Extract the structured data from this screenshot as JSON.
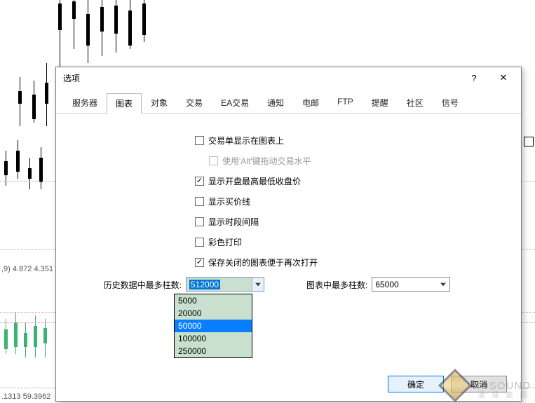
{
  "dialog": {
    "title": "选项",
    "helpGlyph": "?",
    "closeGlyph": "✕"
  },
  "tabs": [
    {
      "label": "服务器"
    },
    {
      "label": "图表"
    },
    {
      "label": "对象"
    },
    {
      "label": "交易"
    },
    {
      "label": "EA交易"
    },
    {
      "label": "通知"
    },
    {
      "label": "电邮"
    },
    {
      "label": "FTP"
    },
    {
      "label": "提醒"
    },
    {
      "label": "社区"
    },
    {
      "label": "信号"
    }
  ],
  "checks": {
    "showTradeOnChart": "交易单显示在图表上",
    "altDrag": "使用'Alt'键拖动交易水平",
    "showOHLC": "显示开盘最高最低收盘价",
    "showAsk": "显示买价线",
    "showPeriod": "显示时段间隔",
    "colorPrint": "彩色打印",
    "saveClosed": "保存关闭的图表便于再次打开"
  },
  "history": {
    "label": "历史数据中最多柱数:",
    "value": "512000",
    "options": [
      "5000",
      "20000",
      "50000",
      "100000",
      "250000"
    ]
  },
  "chartBars": {
    "label": "图表中最多柱数:",
    "value": "65000"
  },
  "buttons": {
    "ok": "确定",
    "cancel": "取消"
  },
  "bg": {
    "ohlc": ",9) 4.872 4.351",
    "coords": ".1313 59.3962"
  },
  "brand": {
    "name": "SiNOSOUND",
    "sub": "漢 聲 集 團"
  },
  "chart_data": {
    "type": "candlestick",
    "note": "background decorative candlestick chart, values not labeled / not legible as data",
    "visible_text": [
      ",9) 4.872 4.351",
      ".1313 59.3962"
    ]
  }
}
